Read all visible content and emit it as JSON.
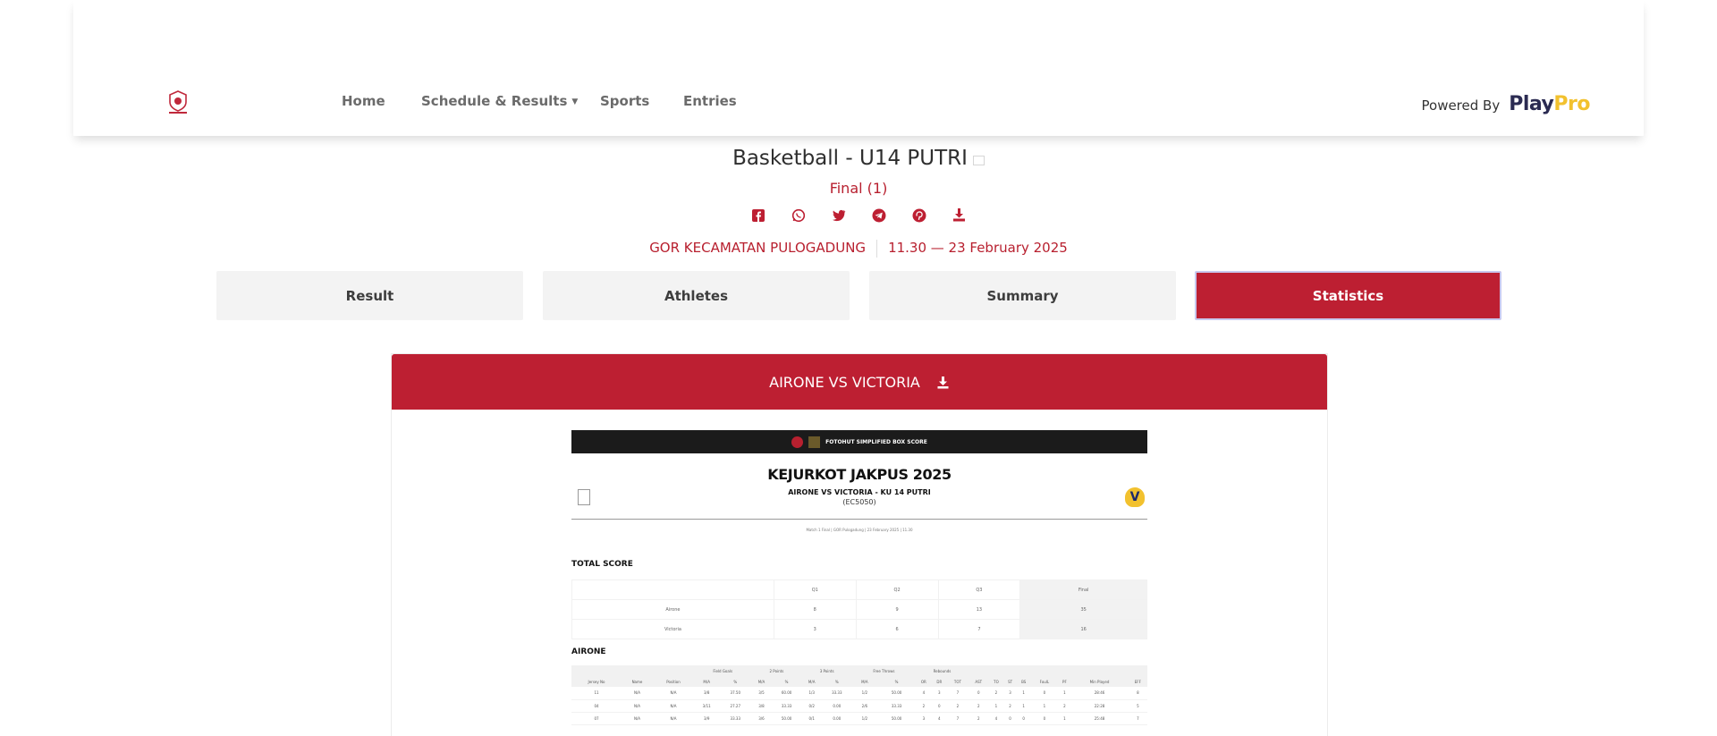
{
  "nav": {
    "items": [
      {
        "label": "Home"
      },
      {
        "label": "Schedule & Results",
        "has_dropdown": true
      },
      {
        "label": "Sports"
      },
      {
        "label": "Entries"
      }
    ],
    "powered_by": "Powered By",
    "brand_play": "Play",
    "brand_pro": "Pro"
  },
  "header": {
    "title": "Basketball - U14 PUTRI",
    "round": "Final (1)",
    "share_icons": [
      "facebook-icon",
      "whatsapp-icon",
      "twitter-icon",
      "telegram-icon",
      "pinterest-icon",
      "download-icon"
    ],
    "venue": "GOR KECAMATAN PULOGADUNG",
    "datetime": "11.30 — 23 February 2025"
  },
  "tabs": [
    {
      "label": "Result",
      "active": false
    },
    {
      "label": "Athletes",
      "active": false
    },
    {
      "label": "Summary",
      "active": false
    },
    {
      "label": "Statistics",
      "active": true
    }
  ],
  "stats": {
    "match_title": "AIRONE VS VICTORIA",
    "report": {
      "bar_text": "FOTOHUT SIMPLIFIED BOX SCORE",
      "event_title": "KEJURKOT JAKPUS 2025",
      "matchup": "AIRONE VS VICTORIA - KU 14 PUTRI",
      "code": "(EC5050)",
      "meta": "Match 1 Final  |  GOR Pulogadung  |  23 February 2025  |  11.30",
      "total_score_label": "TOTAL SCORE",
      "score_headers": [
        "",
        "Q1",
        "Q2",
        "Q3",
        "Final"
      ],
      "score_rows": [
        {
          "team": "Airone",
          "q1": "8",
          "q2": "9",
          "q3": "13",
          "final": "35"
        },
        {
          "team": "Victoria",
          "q1": "3",
          "q2": "6",
          "q3": "7",
          "final": "16"
        }
      ],
      "team_section": "AIRONE",
      "box_headers": [
        "Jersey No",
        "Name",
        "Position",
        "M/A",
        "%",
        "M/A",
        "%",
        "M/A",
        "%",
        "M/A",
        "%",
        "OR",
        "DR",
        "TOT",
        "AST",
        "TO",
        "ST",
        "BS",
        "FoulL",
        "PF",
        "Min Played",
        "EFF"
      ],
      "box_group_headers": [
        "Field Goals",
        "2 Points",
        "3 Points",
        "Free Throws",
        "Rebounds"
      ],
      "box_rows": [
        [
          "11",
          "N/A",
          "N/A",
          "3/8",
          "37.50",
          "3/5",
          "60.00",
          "1/3",
          "33.33",
          "1/2",
          "50.00",
          "4",
          "3",
          "7",
          "0",
          "2",
          "3",
          "1",
          "0",
          "1",
          "28:46",
          "8"
        ],
        [
          "04",
          "N/A",
          "N/A",
          "3/11",
          "27.27",
          "3/8",
          "33.33",
          "0/2",
          "0.00",
          "2/6",
          "33.33",
          "2",
          "0",
          "2",
          "2",
          "1",
          "2",
          "1",
          "1",
          "2",
          "22:28",
          "5"
        ],
        [
          "07",
          "N/A",
          "N/A",
          "3/9",
          "33.33",
          "3/6",
          "50.00",
          "0/1",
          "0.00",
          "1/2",
          "50.00",
          "3",
          "4",
          "7",
          "2",
          "4",
          "0",
          "0",
          "0",
          "1",
          "25:48",
          "7"
        ]
      ]
    }
  },
  "colors": {
    "accent": "#bd1f32",
    "brand_navy": "#2b2b52",
    "brand_gold": "#f2c12e"
  }
}
